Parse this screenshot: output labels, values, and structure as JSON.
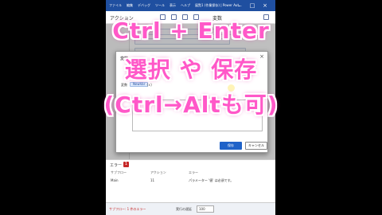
{
  "menubar": {
    "items": [
      "ファイル",
      "編集",
      "デバッグ",
      "ツール",
      "表示",
      "ヘルプ",
      "展覧1 (作業保存) | Power Aut..."
    ]
  },
  "panel": {
    "title": "アクション",
    "variables_label": "変数"
  },
  "dialog": {
    "title": "変数",
    "hint": "",
    "field_label": "変数",
    "chip": "NewVar",
    "chip_suffix": "{x}",
    "ok_label": "保存",
    "cancel_label": "キャンセル"
  },
  "errors": {
    "title": "エラー",
    "count": "1",
    "columns": [
      "サブフロー",
      "アクション",
      "エラー"
    ],
    "row": {
      "subflow": "Main",
      "action": "11",
      "message": "パラメーター '値' は必須です。"
    }
  },
  "statusbar": {
    "left_label": "サブフロー: 1 件のエラー",
    "delay_label": "実行の遅延",
    "delay_value": "100"
  },
  "caption": {
    "line1": "Ctrl + Enter",
    "line2": "選択 や 保存",
    "line3": "(Ctrl→Altも可)"
  }
}
